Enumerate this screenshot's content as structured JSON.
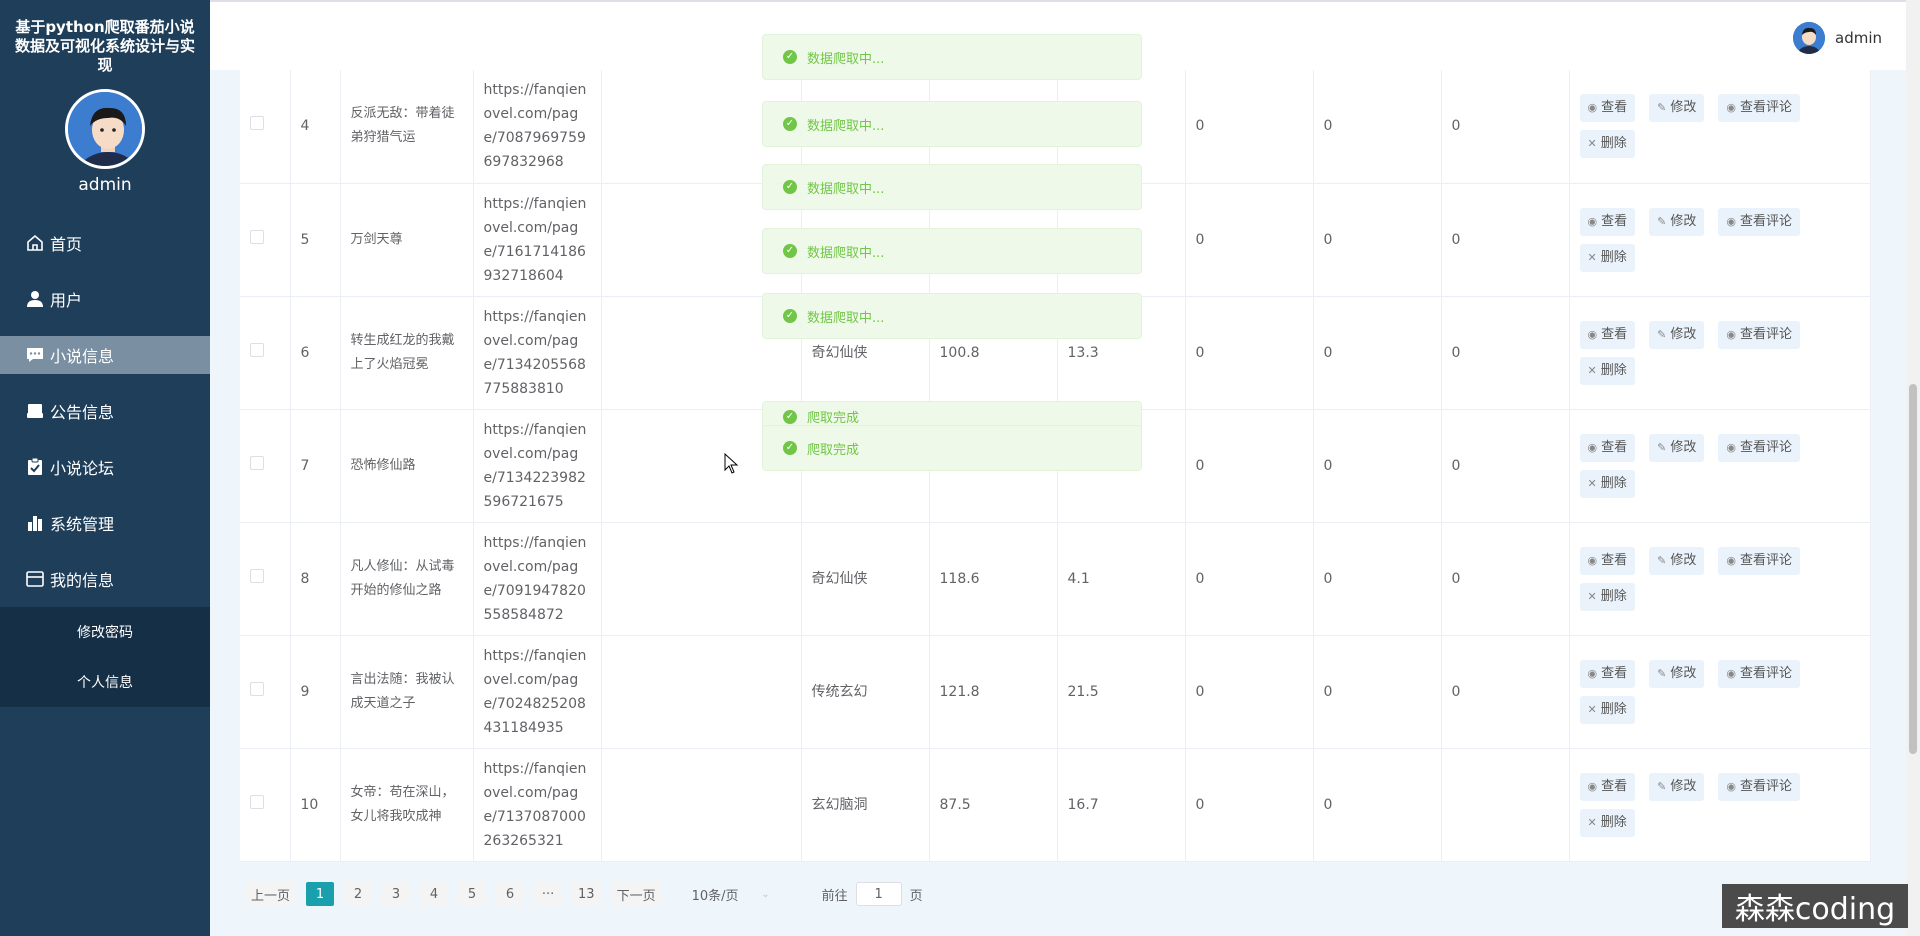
{
  "sidebar": {
    "title": "基于python爬取番茄小说数据及可视化系统设计与实现",
    "username": "admin",
    "menu": [
      {
        "label": "首页",
        "icon": "home-icon"
      },
      {
        "label": "用户",
        "icon": "user-icon"
      },
      {
        "label": "小说信息",
        "icon": "chat-icon"
      },
      {
        "label": "公告信息",
        "icon": "inbox-icon"
      },
      {
        "label": "小说论坛",
        "icon": "clipboard-check-icon"
      },
      {
        "label": "系统管理",
        "icon": "bar-chart-icon"
      },
      {
        "label": "我的信息",
        "icon": "window-icon"
      }
    ],
    "submenu": [
      "修改密码",
      "个人信息"
    ]
  },
  "header": {
    "username": "admin"
  },
  "table": {
    "rows": [
      {
        "index": "4",
        "name": "反派无敌：带着徒弟狩猎气运",
        "url": "https://fanqienovel.com/page/7087969759697832968",
        "category": "",
        "score": "",
        "count": "",
        "c1": "0",
        "c2": "0",
        "c3": "0"
      },
      {
        "index": "5",
        "name": "万剑天尊",
        "url": "https://fanqienovel.com/page/7161714186932718604",
        "category": "",
        "score": "",
        "count": "",
        "c1": "0",
        "c2": "0",
        "c3": "0"
      },
      {
        "index": "6",
        "name": "转生成红龙的我戴上了火焰冠冕",
        "url": "https://fanqienovel.com/page/7134205568775883810",
        "category": "奇幻仙侠",
        "score": "100.8",
        "count": "13.3",
        "c1": "0",
        "c2": "0",
        "c3": "0"
      },
      {
        "index": "7",
        "name": "恐怖修仙路",
        "url": "https://fanqienovel.com/page/7134223982596721675",
        "category": "",
        "score": "",
        "count": "",
        "c1": "0",
        "c2": "0",
        "c3": "0"
      },
      {
        "index": "8",
        "name": "凡人修仙：从试毒开始的修仙之路",
        "url": "https://fanqienovel.com/page/7091947820558584872",
        "category": "奇幻仙侠",
        "score": "118.6",
        "count": "4.1",
        "c1": "0",
        "c2": "0",
        "c3": "0"
      },
      {
        "index": "9",
        "name": "言出法随：我被认成天道之子",
        "url": "https://fanqienovel.com/page/7024825208431184935",
        "category": "传统玄幻",
        "score": "121.8",
        "count": "21.5",
        "c1": "0",
        "c2": "0",
        "c3": "0"
      },
      {
        "index": "10",
        "name": "女帝：苟在深山，女儿将我吹成神",
        "url": "https://fanqienovel.com/page/7137087000263265321",
        "category": "玄幻脑洞",
        "score": "87.5",
        "count": "16.7",
        "c1": "0",
        "c2": "0",
        "c3": ""
      }
    ],
    "ops": {
      "view": "查看",
      "edit": "修改",
      "comments": "查看评论",
      "delete": "删除"
    }
  },
  "toasts": [
    "数据爬取中...",
    "数据爬取中...",
    "数据爬取中...",
    "数据爬取中...",
    "数据爬取中...",
    "爬取完成",
    "爬取完成"
  ],
  "pagination": {
    "prev": "上一页",
    "pages": [
      "1",
      "2",
      "3",
      "4",
      "5",
      "6"
    ],
    "ellipsis": "···",
    "last": "13",
    "next": "下一页",
    "page_size": "10条/页",
    "goto_label": "前往",
    "goto_value": "1",
    "page_suffix": "页"
  },
  "watermark": "森森coding"
}
